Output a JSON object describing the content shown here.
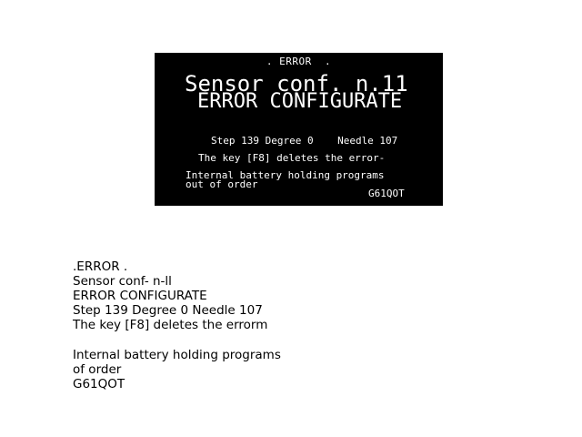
{
  "lcd": {
    "header": ". ERROR  .",
    "title_line1": "Sensor conf. n.11",
    "title_line2": "ERROR CONFIGURATE",
    "step_line": "Step 139 Degree 0    Needle 107",
    "key_line": "The key [F8] deletes the error-",
    "battery_line1": "Internal battery holding programs",
    "battery_line2": "out of order",
    "code": "G61QOT"
  },
  "transcript": {
    "line1": ".ERROR .",
    "line2": "Sensor conf- n-ll",
    "line3": "ERROR CONFIGURATE",
    "line4": "Step 139 Degree 0 Needle 107",
    "line5": "The key [F8] deletes the errorm",
    "line6": "Internal battery holding programs",
    "line7": "of order",
    "line8": "G61QOT"
  }
}
